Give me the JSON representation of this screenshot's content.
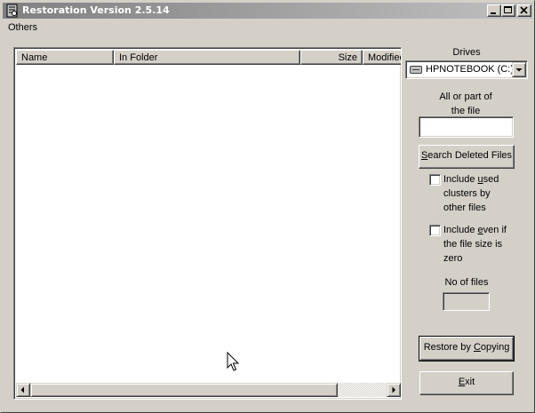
{
  "window": {
    "title": "Restoration Version 2.5.14",
    "icons": [
      "app-icon",
      "minimize-icon",
      "maximize-icon",
      "close-icon"
    ]
  },
  "menu": {
    "items": [
      {
        "label": "Others"
      }
    ]
  },
  "list": {
    "columns": [
      "Name",
      "In Folder",
      "Size",
      "Modified"
    ],
    "rows": []
  },
  "panel": {
    "drives_label": "Drives",
    "drive_selected": "HPNOTEBOOK (C:)",
    "search_label_line1": "All or part of",
    "search_label_line2": "the file",
    "search_value": "",
    "search_button": {
      "pre": "",
      "key": "S",
      "post": "earch Deleted Files"
    },
    "include_used": {
      "line1_pre": "Include ",
      "line1_key": "u",
      "line1_post": "sed",
      "line2": "clusters by",
      "line3": "other files",
      "checked": false
    },
    "include_zero": {
      "line1_pre": "Include ",
      "line1_key": "e",
      "line1_post": "ven if",
      "line2": "the file size is",
      "line3": "zero",
      "checked": false
    },
    "file_count_label": "No of files",
    "file_count_value": "",
    "restore_button": {
      "pre": "Restore by ",
      "key": "C",
      "post": "opying"
    },
    "exit_button": {
      "pre": "",
      "key": "E",
      "post": "xit"
    }
  },
  "colors": {
    "face": "#d4d0c8",
    "titlebar_start": "#808080",
    "titlebar_end": "#c0c0c0"
  }
}
